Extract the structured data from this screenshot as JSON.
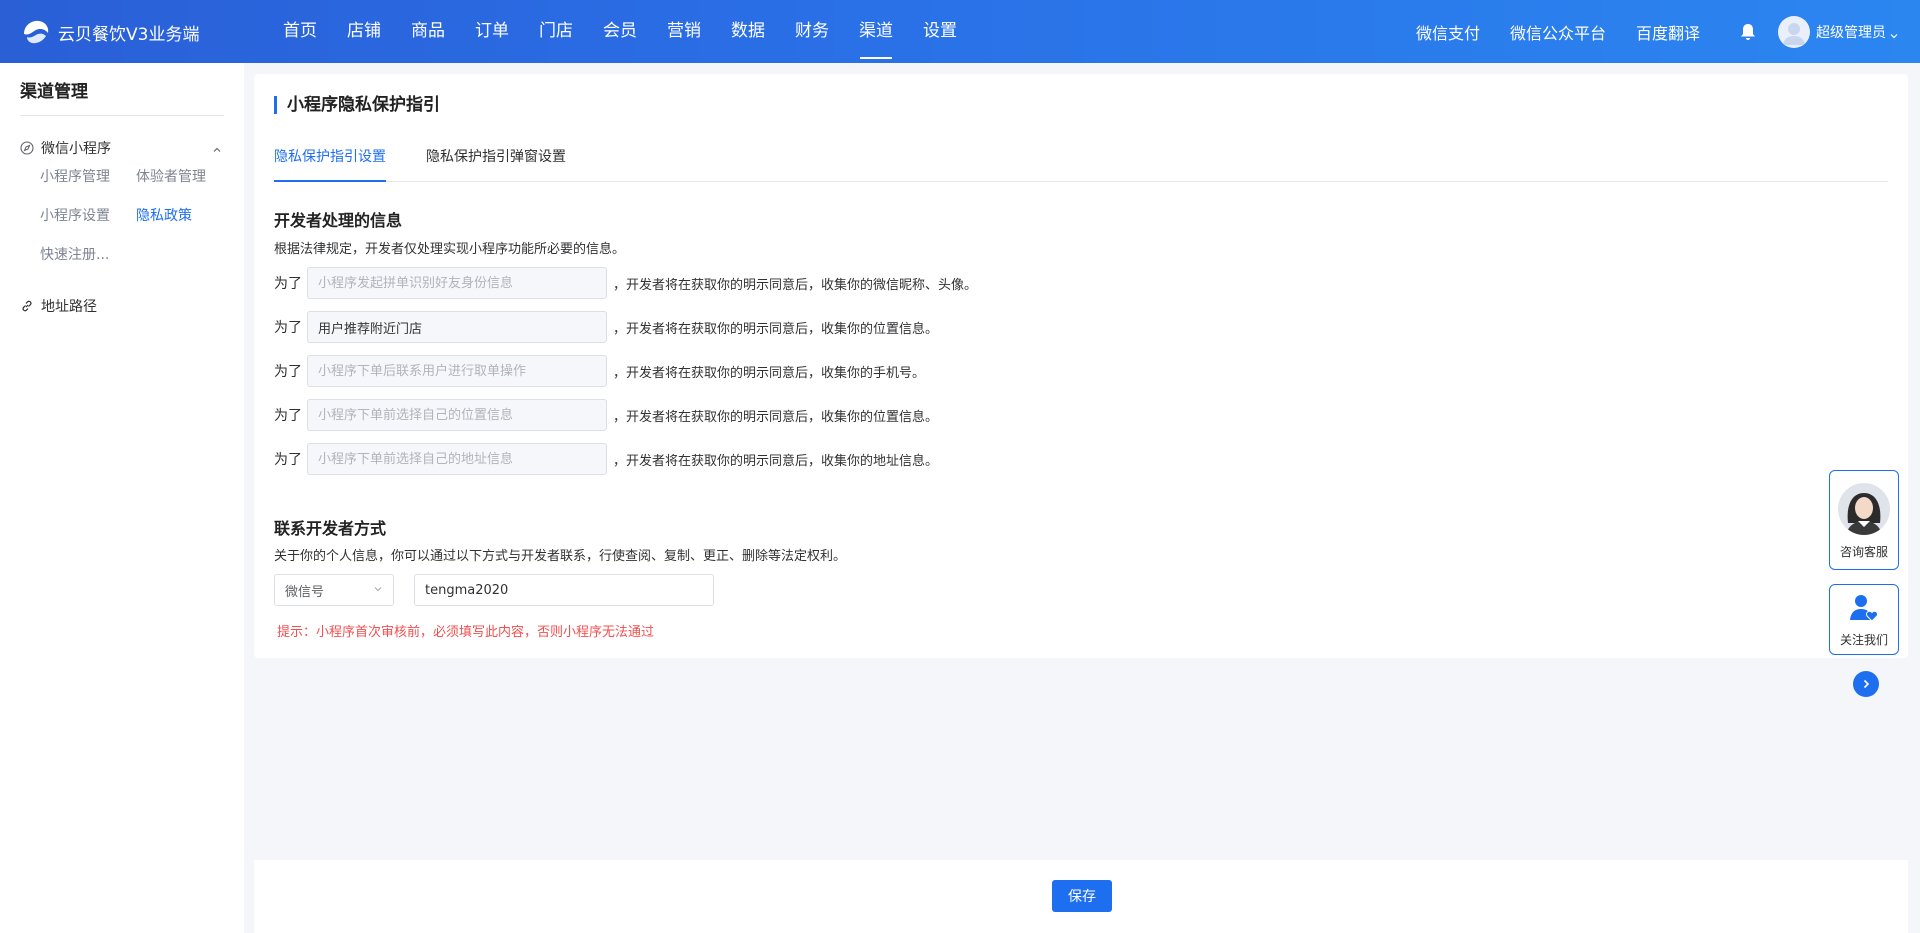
{
  "app": {
    "brand_name": "云贝餐饮V3业务端"
  },
  "nav": {
    "items": [
      "首页",
      "店铺",
      "商品",
      "订单",
      "门店",
      "会员",
      "营销",
      "数据",
      "财务",
      "渠道",
      "设置"
    ],
    "active": "渠道"
  },
  "header_right": {
    "links": [
      "微信支付",
      "微信公众平台",
      "百度翻译"
    ],
    "user_name": "超级管理员"
  },
  "sidebar": {
    "title": "渠道管理",
    "group1": {
      "label": "微信小程序",
      "expanded": true
    },
    "sub_items": [
      "小程序管理",
      "体验者管理",
      "小程序设置",
      "隐私政策",
      "快速注册..."
    ],
    "active_sub": "隐私政策",
    "group2": {
      "label": "地址路径"
    }
  },
  "page": {
    "title": "小程序隐私保护指引",
    "tabs": [
      "隐私保护指引设置",
      "隐私保护指引弹窗设置"
    ],
    "active_tab": "隐私保护指引设置"
  },
  "developer_info": {
    "title": "开发者处理的信息",
    "desc": "根据法律规定，开发者仅处理实现小程序功能所必要的信息。",
    "rows": [
      {
        "prefix": "为了",
        "placeholder": "小程序发起拼单识别好友身份信息",
        "value": "",
        "suffix": "，开发者将在获取你的明示同意后，收集你的微信昵称、头像。"
      },
      {
        "prefix": "为了",
        "placeholder": "",
        "value": "用户推荐附近门店",
        "suffix": "，开发者将在获取你的明示同意后，收集你的位置信息。"
      },
      {
        "prefix": "为了",
        "placeholder": "小程序下单后联系用户进行取单操作",
        "value": "",
        "suffix": "，开发者将在获取你的明示同意后，收集你的手机号。"
      },
      {
        "prefix": "为了",
        "placeholder": "小程序下单前选择自己的位置信息",
        "value": "",
        "suffix": "，开发者将在获取你的明示同意后，收集你的位置信息。"
      },
      {
        "prefix": "为了",
        "placeholder": "小程序下单前选择自己的地址信息",
        "value": "",
        "suffix": "，开发者将在获取你的明示同意后，收集你的地址信息。"
      }
    ]
  },
  "contact": {
    "title": "联系开发者方式",
    "desc": "关于你的个人信息，你可以通过以下方式与开发者联系，行使查阅、复制、更正、删除等法定权利。",
    "method": "微信号",
    "value": "tengma2020",
    "tip": "提示：小程序首次审核前，必须填写此内容，否则小程序无法通过"
  },
  "footer": {
    "save_label": "保存"
  },
  "float": {
    "service_label": "咨询客服",
    "follow_label": "关注我们"
  },
  "colors": {
    "primary": "#1e6ff0",
    "danger": "#f24f4f",
    "header_start": "#2a5fd6",
    "header_end": "#2b86f0"
  },
  "icons": [
    "brand-logo-icon",
    "bell-icon",
    "user-avatar-icon",
    "chevron-down-icon",
    "compass-icon",
    "chevron-up-icon",
    "link-icon",
    "customer-service-avatar",
    "follow-user-icon",
    "chevron-right-icon"
  ]
}
